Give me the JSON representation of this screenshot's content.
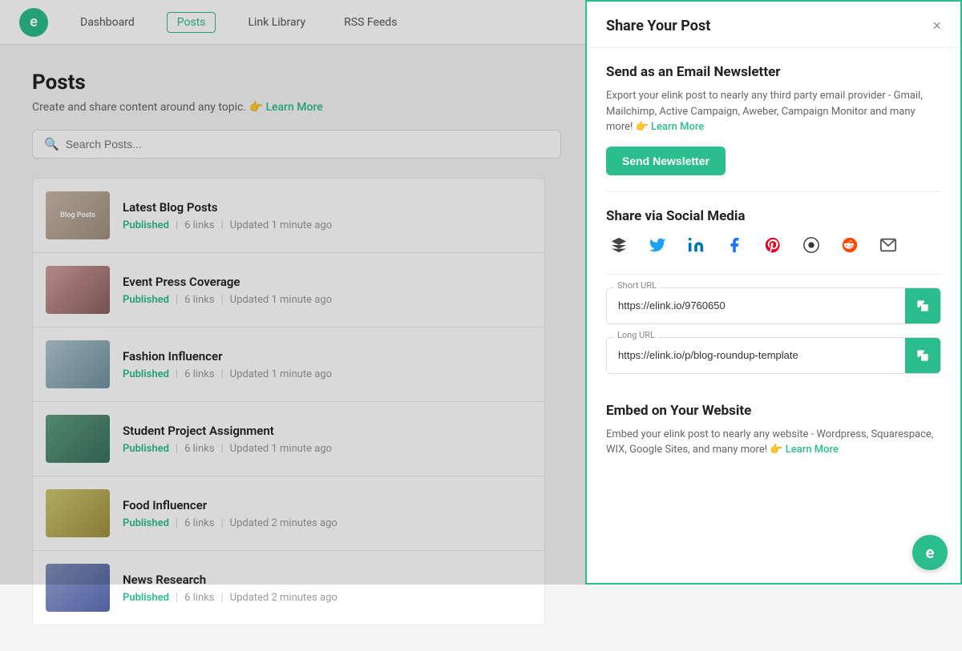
{
  "header": {
    "logo_text": "e",
    "nav": [
      {
        "label": "Dashboard",
        "active": false
      },
      {
        "label": "Posts",
        "active": true
      },
      {
        "label": "Link Library",
        "active": false
      },
      {
        "label": "RSS Feeds",
        "active": false
      }
    ]
  },
  "main": {
    "title": "Posts",
    "subtitle": "Create and share content around any topic.",
    "learn_more": "Learn More",
    "search_placeholder": "Search Posts...",
    "posts": [
      {
        "title": "Latest Blog Posts",
        "status": "Published",
        "links": "6 links",
        "updated": "Updated 1 minute ago",
        "thumb_label": "Blog Posts"
      },
      {
        "title": "Event Press Coverage",
        "status": "Published",
        "links": "6 links",
        "updated": "Updated 1 minute ago",
        "thumb_label": ""
      },
      {
        "title": "Fashion Influencer",
        "status": "Published",
        "links": "6 links",
        "updated": "Updated 1 minute ago",
        "thumb_label": ""
      },
      {
        "title": "Student Project Assignment",
        "status": "Published",
        "links": "6 links",
        "updated": "Updated 1 minute ago",
        "thumb_label": ""
      },
      {
        "title": "Food Influencer",
        "status": "Published",
        "links": "6 links",
        "updated": "Updated 2 minutes ago",
        "thumb_label": ""
      },
      {
        "title": "News Research",
        "status": "Published",
        "links": "6 links",
        "updated": "Updated 2 minutes ago",
        "thumb_label": ""
      }
    ]
  },
  "panel": {
    "title": "Share Your Post",
    "close_label": "×",
    "email_section": {
      "title": "Send as an Email Newsletter",
      "desc": "Export your elink post to nearly any third party email provider - Gmail, Mailchimp, Active Campaign, Aweber, Campaign Monitor and many more!",
      "learn_more": "Learn More",
      "button_label": "Send Newsletter"
    },
    "social_section": {
      "title": "Share via Social Media",
      "icons": [
        {
          "name": "buffer",
          "symbol": "⊞",
          "class": "icon-buffer"
        },
        {
          "name": "twitter",
          "symbol": "𝕋",
          "class": "icon-twitter"
        },
        {
          "name": "linkedin",
          "symbol": "in",
          "class": "icon-linkedin"
        },
        {
          "name": "facebook",
          "symbol": "f",
          "class": "icon-facebook"
        },
        {
          "name": "pinterest",
          "symbol": "P",
          "class": "icon-pinterest"
        },
        {
          "name": "hootsuite",
          "symbol": "◉",
          "class": "icon-hootsuite"
        },
        {
          "name": "reddit",
          "symbol": "⊙",
          "class": "icon-reddit"
        },
        {
          "name": "email",
          "symbol": "✉",
          "class": "icon-email"
        }
      ]
    },
    "short_url": {
      "label": "Short URL",
      "value": "https://elink.io/9760650"
    },
    "long_url": {
      "label": "Long URL",
      "value": "https://elink.io/p/blog-roundup-template"
    },
    "embed_section": {
      "title": "Embed on Your Website",
      "desc": "Embed your elink post to nearly any website - Wordpress, Squarespace, WIX, Google Sites, and many more!",
      "learn_more": "Learn More"
    }
  },
  "colors": {
    "green": "#2bbd8e",
    "link": "#2bbd8e"
  }
}
